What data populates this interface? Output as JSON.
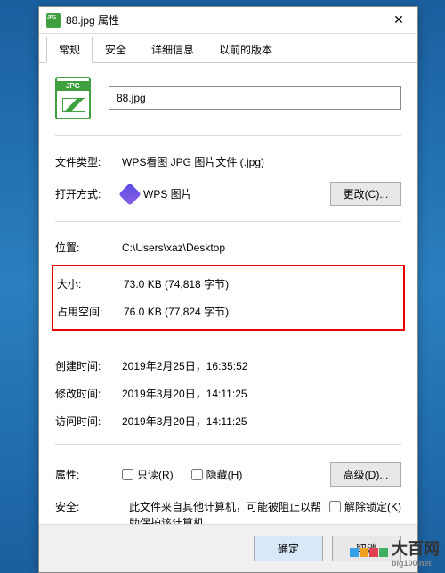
{
  "titlebar": {
    "icon": "jpg-icon",
    "title": "88.jpg 属性",
    "close": "✕"
  },
  "tabs": [
    {
      "label": "常规",
      "active": true
    },
    {
      "label": "安全",
      "active": false
    },
    {
      "label": "详细信息",
      "active": false
    },
    {
      "label": "以前的版本",
      "active": false
    }
  ],
  "filename": "88.jpg",
  "rows": {
    "type_label": "文件类型:",
    "type_value": "WPS看图 JPG 图片文件 (.jpg)",
    "opens_label": "打开方式:",
    "opens_value": "WPS 图片",
    "change_btn": "更改(C)...",
    "location_label": "位置:",
    "location_value": "C:\\Users\\xaz\\Desktop",
    "size_label": "大小:",
    "size_value": "73.0 KB (74,818 字节)",
    "ondisk_label": "占用空间:",
    "ondisk_value": "76.0 KB (77,824 字节)",
    "created_label": "创建时间:",
    "created_value": "2019年2月25日，16:35:52",
    "modified_label": "修改时间:",
    "modified_value": "2019年3月20日，14:11:25",
    "accessed_label": "访问时间:",
    "accessed_value": "2019年3月20日，14:11:25",
    "attr_label": "属性:",
    "readonly": "只读(R)",
    "hidden": "隐藏(H)",
    "advanced_btn": "高级(D)...",
    "security_label": "安全:",
    "security_text": "此文件来自其他计算机，可能被阻止以帮助保护该计算机。",
    "unblock": "解除锁定(K)"
  },
  "buttons": {
    "ok": "确定",
    "cancel": "取消"
  },
  "watermark": {
    "text": "大百网",
    "sub": "big100.net"
  }
}
